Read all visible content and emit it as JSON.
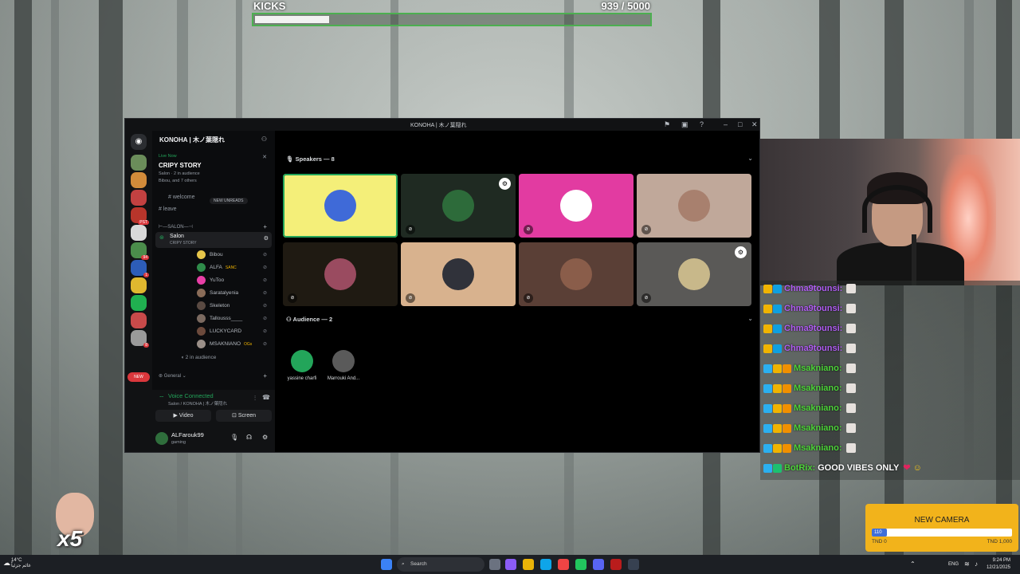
{
  "overlay": {
    "kicks": {
      "label": "KICKS",
      "current": 939,
      "goal": 5000,
      "count_text": "939 / 5000"
    },
    "goal": {
      "title": "NEW CAMERA",
      "progress_label": "110",
      "progress": 0.11,
      "min_label": "TND 0",
      "max_label": "TND 1,000"
    },
    "sticker": {
      "text": "x5"
    }
  },
  "discord": {
    "window_title": "KONOHA | 木ノ葉隠れ",
    "server_name": "KONOHA | 木ノ葉隠れ",
    "live": {
      "live_now": "Live Now",
      "stage_title": "CRIPY STORY",
      "sub_channel": "Salon",
      "sub_audience": "2 in audience",
      "speakers_preview": "Bibou",
      "speakers_more": "and 7 others"
    },
    "new_unreads": "NEW UNREADS",
    "channels": {
      "welcome": "welcome",
      "leave": "leave",
      "category_salon": "SALON",
      "salon": "Salon",
      "salon_topic": "CRIPY STORY",
      "category_general": "General"
    },
    "members": [
      {
        "name": "Bibou",
        "color": "#e7c64a"
      },
      {
        "name": "ALFA",
        "tag": "SANC",
        "color": "#2f8c4a"
      },
      {
        "name": "YuToo",
        "color": "#e83fa6"
      },
      {
        "name": "Saratalyenia",
        "color": "#8a6c58"
      },
      {
        "name": "Skeleton",
        "color": "#5a4a42"
      },
      {
        "name": "Tallousss____",
        "color": "#7b6a60"
      },
      {
        "name": "LUCKYCARD",
        "color": "#6c4a3c"
      },
      {
        "name": "MSAKNIANO",
        "tag": "OGs",
        "color": "#9a8f88"
      }
    ],
    "members_audience": "2 in audience",
    "voice": {
      "status": "Voice Connected",
      "location": "Salon / KONOHA | 木ノ葉隠れ",
      "video_label": "Video",
      "screen_label": "Screen"
    },
    "user": {
      "name": "ALFarouk99",
      "status": "gaming"
    },
    "stage": {
      "speakers_header": "Speakers — 8",
      "audience_header": "Audience — 2",
      "speakers": [
        {
          "bg": "#f4ef79",
          "av": "#3f6ad8"
        },
        {
          "bg": "#1f2a22",
          "av": "#2d6b3a"
        },
        {
          "bg": "#e23ba1",
          "av": "#ffffff"
        },
        {
          "bg": "#c0a89a",
          "av": "#a8806e"
        },
        {
          "bg": "#1f1a12",
          "av": "#9a4b60"
        },
        {
          "bg": "#d8b28e",
          "av": "#30323a"
        },
        {
          "bg": "#5a3f36",
          "av": "#8a5d4a"
        },
        {
          "bg": "#5a5957",
          "av": "#c8b88a"
        }
      ],
      "audience": [
        {
          "name": "yassine charfi",
          "av": "#23a55a"
        },
        {
          "name": "Marrouki And...",
          "av": "#5a5a5a"
        }
      ]
    },
    "server_icons": [
      {
        "color": "#6b8d5a"
      },
      {
        "color": "#d28b3a"
      },
      {
        "color": "#c24141"
      },
      {
        "color": "#b8352b",
        "badge": "PST"
      },
      {
        "color": "#d9d9d9"
      },
      {
        "color": "#4b8d4b",
        "badge": "94"
      },
      {
        "color": "#2d5db8",
        "badge": "1"
      },
      {
        "color": "#e0b82f"
      },
      {
        "color": "#20b050"
      },
      {
        "color": "#c84a4a"
      },
      {
        "color": "#9a9a9a",
        "badge": "8"
      }
    ],
    "new_badge": "NEW"
  },
  "chat": {
    "messages": [
      {
        "user": "Chma9tounsi:",
        "color": "#b05cf2",
        "badges": [
          "#f0b400",
          "#0fa0e0"
        ]
      },
      {
        "user": "Chma9tounsi:",
        "color": "#b05cf2",
        "badges": [
          "#f0b400",
          "#0fa0e0"
        ]
      },
      {
        "user": "Chma9tounsi:",
        "color": "#b05cf2",
        "badges": [
          "#f0b400",
          "#0fa0e0"
        ]
      },
      {
        "user": "Chma9tounsi:",
        "color": "#b05cf2",
        "badges": [
          "#f0b400",
          "#0fa0e0"
        ]
      },
      {
        "user": "Msakniano:",
        "color": "#4ed43a",
        "badges": [
          "#2bb0f0",
          "#f0b400",
          "#f09000"
        ]
      },
      {
        "user": "Msakniano:",
        "color": "#4ed43a",
        "badges": [
          "#2bb0f0",
          "#f0b400",
          "#f09000"
        ]
      },
      {
        "user": "Msakniano:",
        "color": "#4ed43a",
        "badges": [
          "#2bb0f0",
          "#f0b400",
          "#f09000"
        ]
      },
      {
        "user": "Msakniano:",
        "color": "#4ed43a",
        "badges": [
          "#2bb0f0",
          "#f0b400",
          "#f09000"
        ]
      },
      {
        "user": "Msakniano:",
        "color": "#4ed43a",
        "badges": [
          "#2bb0f0",
          "#f0b400",
          "#f09000"
        ]
      },
      {
        "user": "BotRix:",
        "color": "#4ed43a",
        "badges": [
          "#2bb0f0",
          "#1cc070"
        ],
        "text": "GOOD VIBES ONLY"
      }
    ]
  },
  "taskbar": {
    "weather_temp": "14°C",
    "weather_desc": "غائم جزئياً",
    "search_placeholder": "Search",
    "language": "ENG",
    "time": "9:24 PM",
    "date": "12/21/2025"
  }
}
